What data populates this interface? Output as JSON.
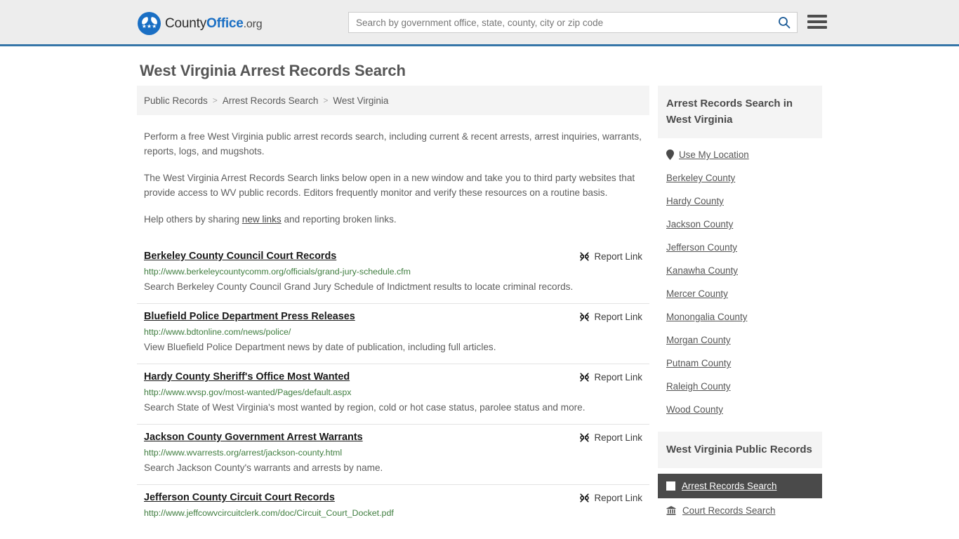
{
  "header": {
    "logo": {
      "text_part1": "County",
      "text_part2": "Office",
      "text_tld": ".org",
      "stars": "★★★",
      "icon": "eagle-shield-logo"
    },
    "search": {
      "placeholder": "Search by government office, state, county, city or zip code",
      "value": "",
      "search_icon": "search-icon"
    },
    "menu_icon": "hamburger-menu-icon",
    "accent_color": "#3575a8",
    "background_color": "#ededed"
  },
  "page_title": "West Virginia Arrest Records Search",
  "breadcrumb": {
    "items": [
      {
        "label": "Public Records",
        "current": false
      },
      {
        "label": "Arrest Records Search",
        "current": false
      },
      {
        "label": "West Virginia",
        "current": true
      }
    ],
    "separator": ">"
  },
  "intro": {
    "paragraph1": "Perform a free West Virginia public arrest records search, including current & recent arrests, arrest inquiries, warrants, reports, logs, and mugshots.",
    "paragraph2": "The West Virginia Arrest Records Search links below open in a new window and take you to third party websites that provide access to WV public records. Editors frequently monitor and verify these resources on a routine basis.",
    "paragraph3_before": "Help others by sharing ",
    "paragraph3_link": "new links",
    "paragraph3_after": " and reporting broken links."
  },
  "results": {
    "report_label": "Report Link",
    "report_icon": "broken-link-icon",
    "items": [
      {
        "title": "Berkeley County Council Court Records",
        "url": "http://www.berkeleycountycomm.org/officials/grand-jury-schedule.cfm",
        "description": "Search Berkeley County Council Grand Jury Schedule of Indictment results to locate criminal records."
      },
      {
        "title": "Bluefield Police Department Press Releases",
        "url": "http://www.bdtonline.com/news/police/",
        "description": "View Bluefield Police Department news by date of publication, including full articles."
      },
      {
        "title": "Hardy County Sheriff's Office Most Wanted",
        "url": "http://www.wvsp.gov/most-wanted/Pages/default.aspx",
        "description": "Search State of West Virginia's most wanted by region, cold or hot case status, parolee status and more."
      },
      {
        "title": "Jackson County Government Arrest Warrants",
        "url": "http://www.wvarrests.org/arrest/jackson-county.html",
        "description": "Search Jackson County's warrants and arrests by name."
      },
      {
        "title": "Jefferson County Circuit Court Records",
        "url": "http://www.jeffcowvcircuitclerk.com/doc/Circuit_Court_Docket.pdf",
        "description": ""
      }
    ]
  },
  "sidebar": {
    "counties_heading": "Arrest Records Search in West Virginia",
    "use_my_location": {
      "label": "Use My Location",
      "icon": "map-pin-icon"
    },
    "counties": [
      {
        "label": "Berkeley County"
      },
      {
        "label": "Hardy County"
      },
      {
        "label": "Jackson County"
      },
      {
        "label": "Jefferson County"
      },
      {
        "label": "Kanawha County"
      },
      {
        "label": "Mercer County"
      },
      {
        "label": "Monongalia County"
      },
      {
        "label": "Morgan County"
      },
      {
        "label": "Putnam County"
      },
      {
        "label": "Raleigh County"
      },
      {
        "label": "Wood County"
      }
    ],
    "public_records_heading": "West Virginia Public Records",
    "record_types": [
      {
        "label": "Arrest Records Search",
        "icon": "square-icon",
        "active": true
      },
      {
        "label": "Court Records Search",
        "icon": "courthouse-icon",
        "active": false
      }
    ],
    "active_background": "#4a4a4a"
  }
}
